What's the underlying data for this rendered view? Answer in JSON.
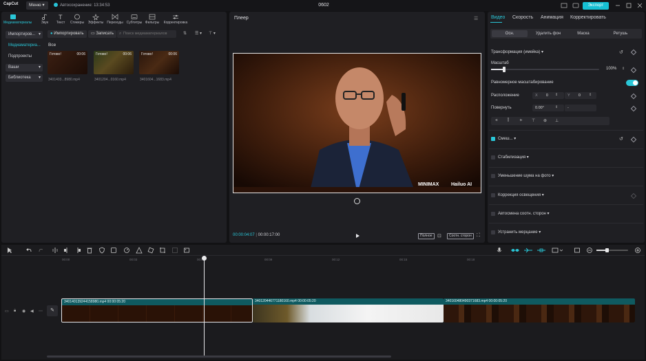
{
  "titlebar": {
    "app_name": "CapCut",
    "menu_label": "Меню",
    "autosave": "Автосохранение: 13:34:53",
    "project_name": "0602",
    "export_label": "Экспорт"
  },
  "toolbar_tabs": [
    {
      "label": "Медиаматериалы",
      "icon": "media-icon",
      "active": true
    },
    {
      "label": "Звук",
      "icon": "audio-icon"
    },
    {
      "label": "Текст",
      "icon": "text-icon"
    },
    {
      "label": "Стикеры",
      "icon": "sticker-icon"
    },
    {
      "label": "Эффекты",
      "icon": "effects-icon"
    },
    {
      "label": "Переходы",
      "icon": "transitions-icon"
    },
    {
      "label": "Субтитры",
      "icon": "subtitles-icon"
    },
    {
      "label": "Фильтры",
      "icon": "filters-icon"
    },
    {
      "label": "Корректировка",
      "icon": "adjust-icon"
    }
  ],
  "sidebar": {
    "items": [
      {
        "label": "Импортиров..."
      },
      {
        "label": "Медиаматериа..."
      },
      {
        "label": "Подпроекты"
      },
      {
        "label": "Ваши"
      },
      {
        "label": "Библиотека"
      }
    ]
  },
  "media": {
    "import_label": "Импортировать",
    "record_label": "Записать",
    "search_placeholder": "Поиск медиаматериалов",
    "all_label": "Все",
    "thumbs": [
      {
        "tag": "Готово!",
        "duration": "00:06",
        "name": "3401403...8980.mp4"
      },
      {
        "tag": "Готово!",
        "duration": "00:06",
        "name": "3401204...0160.mp4"
      },
      {
        "tag": "Готово!",
        "duration": "00:06",
        "name": "3401604...1683.mp4"
      }
    ]
  },
  "player": {
    "title": "Плеер",
    "watermark_minimax": "MINIMAX",
    "watermark_hailuo": "Hailuo AI",
    "time_current": "00:00:04:07",
    "time_total": "00:00:17:00",
    "full_label": "Полное",
    "ratio_label": "Соотн. сторон"
  },
  "props": {
    "tabs": [
      "Видео",
      "Скорость",
      "Анимация",
      "Корректировать"
    ],
    "subtabs": [
      "Осн.",
      "Удалить фон",
      "Маска",
      "Ретушь"
    ],
    "transform_label": "Трансформация (имейка)",
    "scale_label": "Масштаб",
    "scale_value": "100%",
    "scale_fraction": 0.12,
    "uniform_label": "Равномерное масштабирование",
    "position_label": "Расположение",
    "pos_x_label": "X",
    "pos_x": "0",
    "pos_y_label": "Y",
    "pos_y": "0",
    "rotate_label": "Повернуть",
    "rotate_value": "0.00°",
    "rotate_extra": "-",
    "blend_label": "Смеш...",
    "sections": [
      {
        "label": "Стабилизация",
        "checked": false
      },
      {
        "label": "Уменьшение шума на фото",
        "checked": false
      },
      {
        "label": "Коррекция освещения",
        "checked": false
      },
      {
        "label": "Автосмена соотн. сторон",
        "checked": false
      },
      {
        "label": "Устранить мерцание",
        "checked": false
      }
    ]
  },
  "timeline": {
    "ticks": [
      "00:00",
      "00:03",
      "00:06",
      "00:09",
      "00:12",
      "00:15",
      "00:18"
    ],
    "clips": [
      {
        "label": "340140139244158980.mp4  00:00:05:20"
      },
      {
        "label": "340120446771180160.mp4  00:00:05:20"
      },
      {
        "label": "340160480490371683.mp4  00:00:05:20"
      }
    ]
  },
  "colors": {
    "accent": "#2ac7d8",
    "panel": "#1f1f23",
    "clip": "#0f5a60"
  }
}
